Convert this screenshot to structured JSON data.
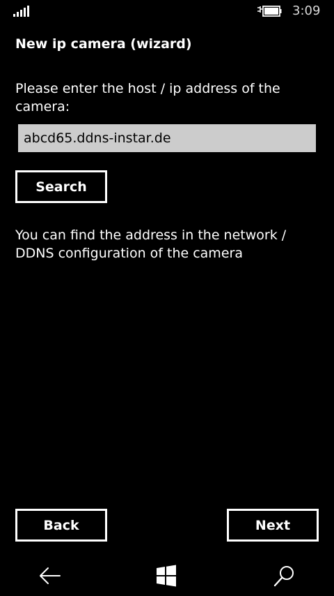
{
  "status_bar": {
    "signal_icon": "signal-bars-icon",
    "battery_icon": "battery-charging-icon",
    "time": "3:09"
  },
  "page": {
    "title": "New ip camera (wizard)",
    "prompt": "Please enter the host / ip address of the camera:",
    "host_input": {
      "value": "abcd65.ddns-instar.de",
      "placeholder": ""
    },
    "search_label": "Search",
    "help_text": "You can find the address in the network / DDNS configuration of the camera",
    "back_label": "Back",
    "next_label": "Next"
  },
  "nav_bar": {
    "back_icon": "back-arrow-icon",
    "start_icon": "windows-start-icon",
    "search_icon": "search-icon"
  },
  "colors": {
    "background": "#000000",
    "text": "#ffffff",
    "input_background": "#cccccc",
    "input_text": "#000000"
  }
}
